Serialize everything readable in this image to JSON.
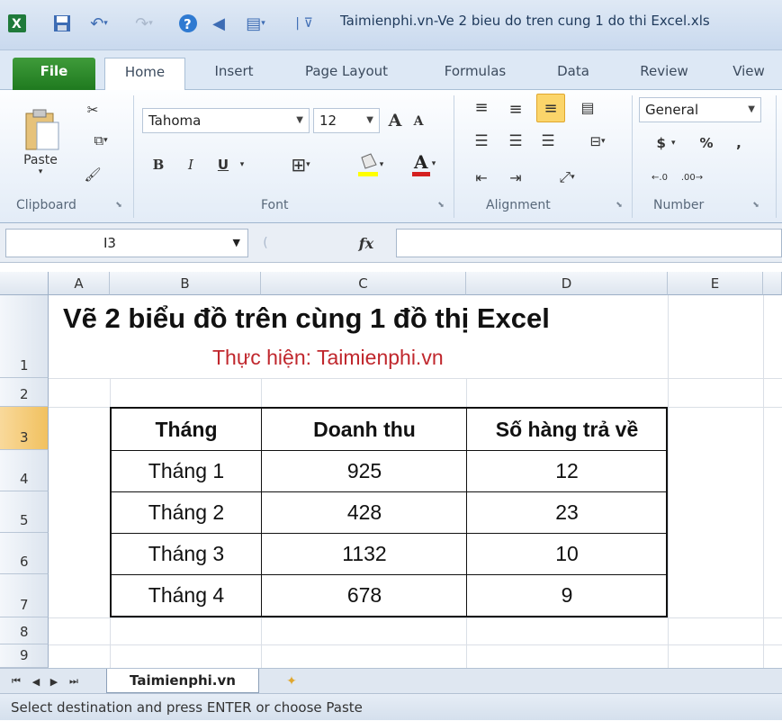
{
  "window": {
    "title": "Taimienphi.vn-Ve 2 bieu do tren cung 1 do thi Excel.xls"
  },
  "ribbon_tabs": [
    "File",
    "Home",
    "Insert",
    "Page Layout",
    "Formulas",
    "Data",
    "Review",
    "View"
  ],
  "clipboard": {
    "paste_label": "Paste",
    "group_label": "Clipboard"
  },
  "font": {
    "name": "Tahoma",
    "size": "12",
    "bold": "B",
    "italic": "I",
    "underline": "U",
    "group_label": "Font"
  },
  "alignment": {
    "group_label": "Alignment"
  },
  "number": {
    "format": "General",
    "currency": "$",
    "percent": "%",
    "comma": ",",
    "group_label": "Number"
  },
  "formula_bar": {
    "name_box": "I3",
    "fx": "fx",
    "value": ""
  },
  "columns": [
    "A",
    "B",
    "C",
    "D",
    "E"
  ],
  "rows": [
    "1",
    "2",
    "3",
    "4",
    "5",
    "6",
    "7",
    "8",
    "9"
  ],
  "sheet": {
    "title": "Vẽ 2 biểu đồ trên cùng 1 đồ thị Excel",
    "subtitle": "Thực hiện: Taimienphi.vn",
    "headers": [
      "Tháng",
      "Doanh thu",
      "Số hàng trả về"
    ],
    "rows": [
      [
        "Tháng 1",
        "925",
        "12"
      ],
      [
        "Tháng 2",
        "428",
        "23"
      ],
      [
        "Tháng 3",
        "1132",
        "10"
      ],
      [
        "Tháng 4",
        "678",
        "9"
      ]
    ]
  },
  "sheet_tabs": {
    "active": "Taimienphi.vn"
  },
  "status": {
    "message": "Select destination and press ENTER or choose Paste"
  },
  "colors": {
    "subtitle": "#c0272d",
    "file_tab": "#2a8a2a",
    "selected_header": "#f4c96b"
  }
}
